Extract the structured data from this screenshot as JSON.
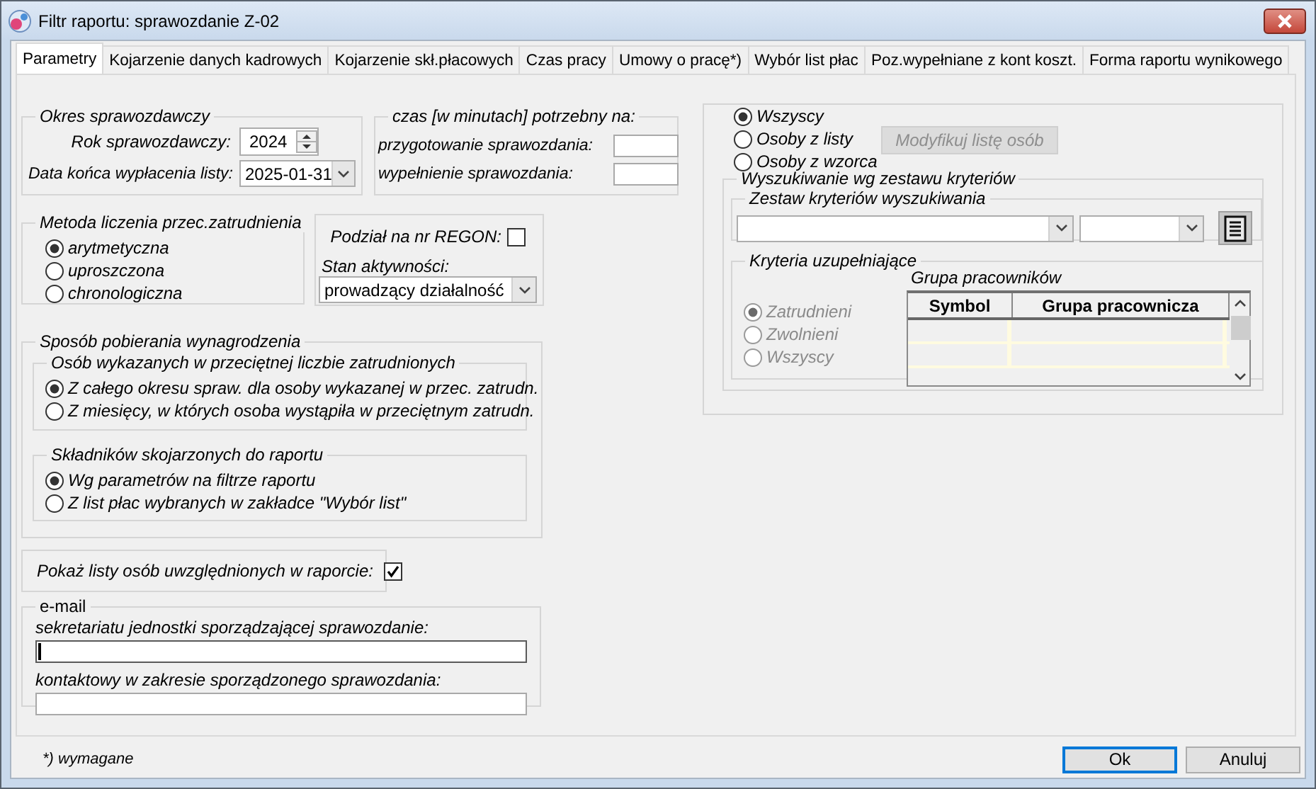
{
  "window": {
    "title": "Filtr raportu: sprawozdanie Z-02"
  },
  "tabs": [
    {
      "label": "Parametry",
      "selected": true
    },
    {
      "label": "Kojarzenie danych kadrowych",
      "selected": false
    },
    {
      "label": "Kojarzenie skł.płacowych",
      "selected": false
    },
    {
      "label": "Czas pracy",
      "selected": false
    },
    {
      "label": "Umowy o pracę*)",
      "selected": false
    },
    {
      "label": "Wybór list płac",
      "selected": false
    },
    {
      "label": "Poz.wypełniane z kont koszt.",
      "selected": false
    },
    {
      "label": "Forma raportu wynikowego",
      "selected": false
    }
  ],
  "okres": {
    "title": "Okres sprawozdawczy",
    "rok": {
      "label": "Rok sprawozdawczy:",
      "value": "2024"
    },
    "data": {
      "label": "Data końca wypłacenia listy:",
      "value": "2025-01-31"
    }
  },
  "czas": {
    "title": "czas [w minutach] potrzebny na:",
    "fields": [
      {
        "label": "przygotowanie sprawozdania:"
      },
      {
        "label": "wypełnienie sprawozdania:"
      }
    ]
  },
  "metoda": {
    "title": "Metoda liczenia przec.zatrudnienia",
    "options": [
      {
        "label": "arytmetyczna",
        "selected": true
      },
      {
        "label": "uproszczona",
        "selected": false
      },
      {
        "label": "chronologiczna",
        "selected": false
      }
    ]
  },
  "regon": {
    "label": "Podział na nr REGON:",
    "checked": false,
    "stan": {
      "label": "Stan aktywności:",
      "value": "prowadzący działalność"
    }
  },
  "sposob": {
    "title": "Sposób pobierania wynagrodzenia",
    "groups": [
      {
        "title": "Osób wykazanych w przeciętnej liczbie zatrudnionych",
        "options": [
          {
            "label": "Z całego okresu spraw. dla osoby wykazanej w przec. zatrudn.",
            "selected": true
          },
          {
            "label": "Z miesięcy, w których osoba wystąpiła w przeciętnym zatrudn.",
            "selected": false
          }
        ]
      },
      {
        "title": "Składników skojarzonych do raportu",
        "options": [
          {
            "label": "Wg parametrów na filtrze raportu",
            "selected": true
          },
          {
            "label": "Z list płac wybranych w zakładce \"Wybór list\"",
            "selected": false
          }
        ]
      }
    ]
  },
  "pokaz": {
    "label": "Pokaż listy osób uwzględnionych w raporcie:",
    "checked": true
  },
  "email": {
    "title": "e-mail",
    "fields": [
      {
        "label": "sekretariatu jednostki sporządzającej sprawozdanie:",
        "focused": true
      },
      {
        "label": "kontaktowy w zakresie sporządzonego sprawozdania:",
        "focused": false
      }
    ]
  },
  "osoby": {
    "options": [
      {
        "label": "Wszyscy",
        "selected": true
      },
      {
        "label": "Osoby z listy",
        "selected": false
      },
      {
        "label": "Osoby z wzorca",
        "selected": false
      }
    ],
    "button": {
      "label": "Modyfikuj listę osób",
      "disabled": true
    }
  },
  "wyszukiwanie": {
    "title": "Wyszukiwanie wg zestawu kryteriów",
    "zestaw": {
      "title": "Zestaw kryteriów wyszukiwania"
    },
    "kryteria": {
      "title": "Kryteria uzupełniające",
      "options": [
        {
          "label": "Zatrudnieni",
          "selected": true,
          "disabled": true
        },
        {
          "label": "Zwolnieni",
          "selected": false,
          "disabled": true
        },
        {
          "label": "Wszyscy",
          "selected": false,
          "disabled": true
        }
      ],
      "grupa": {
        "title": "Grupa pracowników",
        "columns": [
          "Symbol",
          "Grupa pracownicza"
        ]
      }
    }
  },
  "footer": {
    "note": "*) wymagane"
  },
  "buttons": [
    {
      "label": "Ok",
      "default": true
    },
    {
      "label": "Anuluj",
      "default": false
    }
  ]
}
